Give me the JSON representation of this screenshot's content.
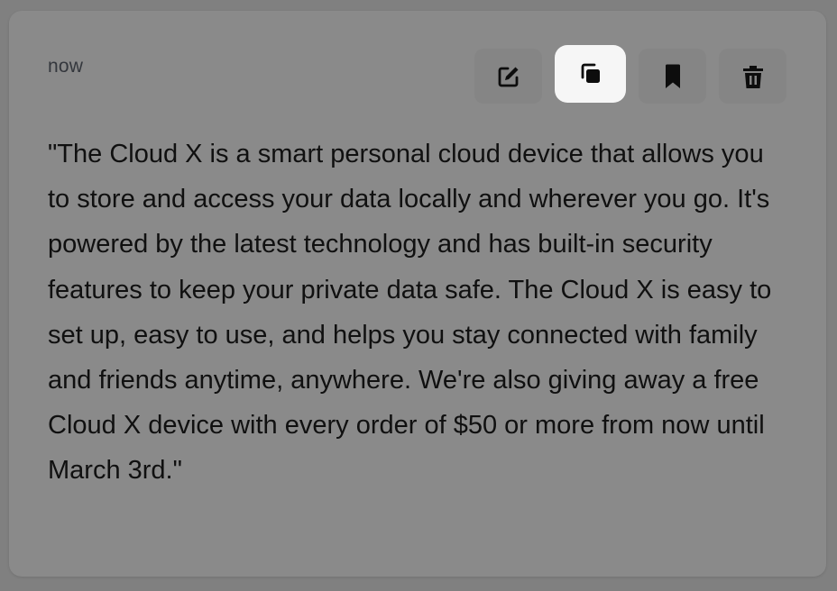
{
  "card": {
    "timestamp": "now",
    "message": "\"The Cloud X is a smart personal cloud device that allows you to store and access your data locally and wherever you go. It's powered by the latest technology and has built-in security features to keep your private data safe. The Cloud X is easy to set up, easy to use, and helps you stay connected with family and friends anytime, anywhere. We're also giving away a free Cloud X device with every order of $50 or more from now until March 3rd.\""
  },
  "actions": [
    {
      "name": "edit",
      "icon": "edit-icon",
      "active": false
    },
    {
      "name": "copy",
      "icon": "copy-icon",
      "active": true
    },
    {
      "name": "bookmark",
      "icon": "bookmark-icon",
      "active": false
    },
    {
      "name": "delete",
      "icon": "trash-icon",
      "active": false
    }
  ],
  "colors": {
    "background": "#808080",
    "card": "#8a8a8a",
    "button": "#858585",
    "button_active": "#f6f6f6",
    "text": "#101010",
    "timestamp": "#34373d"
  }
}
